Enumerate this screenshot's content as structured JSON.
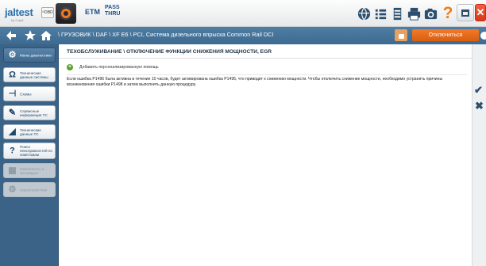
{
  "toolbar": {
    "logo_main": "jaltest",
    "logo_sub": "by Cojali",
    "obd_label": "ᴳOBD",
    "etm_label": "ETM",
    "pass_line1": "PASS",
    "pass_line2": "THRU",
    "help_label": "?",
    "close_label": "✕"
  },
  "nav": {
    "path": "\\ ГРУЗОВИК \\ DAF \\ XF E6 \\ PCI, Система дизельного впрыска Common Rail DCI",
    "disconnect_label": "Отключиться"
  },
  "sidebar": {
    "items": [
      {
        "label": "Меню диагностики",
        "icon": "diagnostics-icon",
        "state": "active"
      },
      {
        "label": "Технические данные системы",
        "icon": "omega-icon",
        "state": "normal"
      },
      {
        "label": "Схемы",
        "icon": "schematic-icon",
        "state": "normal"
      },
      {
        "label": "Сервисные информация ТС",
        "icon": "service-icon",
        "state": "normal"
      },
      {
        "label": "Технические данные ТС",
        "icon": "vehicle-icon",
        "state": "normal"
      },
      {
        "label": "Поиск неисправностей по симптомам",
        "icon": "troubleshoot-icon",
        "state": "normal"
      },
      {
        "label": "Компоненты и процедуры",
        "icon": "components-icon",
        "state": "disabled"
      },
      {
        "label": "Характеристики",
        "icon": "specs-icon",
        "state": "disabled"
      }
    ]
  },
  "main": {
    "title": "ТЕХОБСЛУЖИВАНИЕ \\ ОТКЛЮЧЕНИЕ ФУНКЦИИ СНИЖЕНИЯ МОЩНОСТИ, EGR",
    "add_help_label": "Добавить персонализированную помощь",
    "body_text": "Если ошибка P1496 была активна в течение 10 часов, будет активирована ошибка P1495, что приводит к снижению мощности. Чтобы отключить снижение мощности, необходимо устранить причины возникновения ошибки P1498 и затем выполнить данную процедуру."
  },
  "colors": {
    "accent_blue": "#3d6a90",
    "sidebar_blue": "#3b6388",
    "orange": "#ec7d1e",
    "close_red": "#d83818",
    "green_plus": "#5aa02c"
  }
}
